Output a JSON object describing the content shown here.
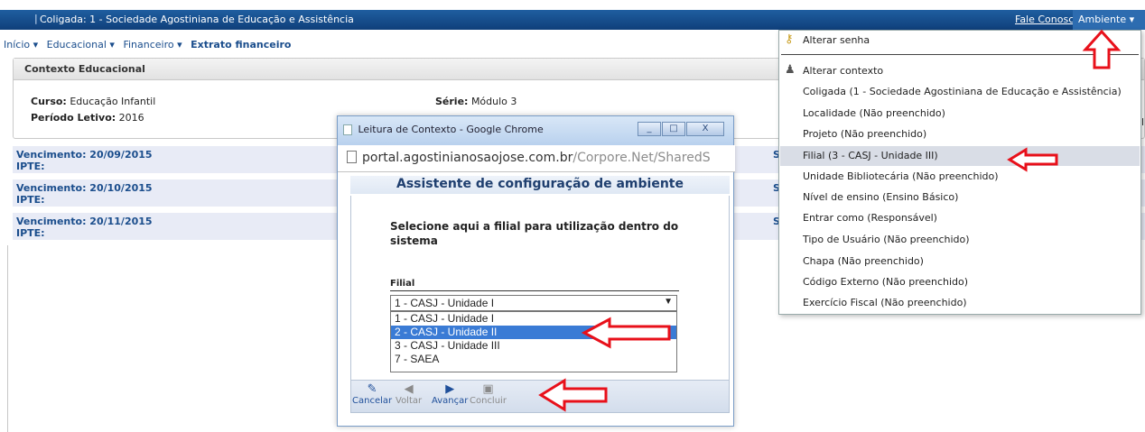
{
  "topbar": {
    "pipe": "|",
    "coligada": "Coligada: 1 - Sociedade Agostiniana de Educação e Assistência",
    "fale_conosco": "Fale Conosco",
    "ambiente": "Ambiente ▾"
  },
  "menubar": {
    "inicio": "Início ▾",
    "educacional": "Educacional ▾",
    "financeiro": "Financeiro ▾",
    "extrato": "Extrato financeiro"
  },
  "contexto": {
    "title": "Contexto Educacional",
    "curso_label": "Curso:",
    "curso_value": "Educação Infantil",
    "periodo_label": "Período Letivo:",
    "periodo_value": "2016",
    "serie_label": "Série:",
    "serie_value": "Módulo 3"
  },
  "boletos": [
    {
      "vencimento": "Vencimento: 20/09/2015",
      "ipte": "IPTE:",
      "s": "S"
    },
    {
      "vencimento": "Vencimento: 20/10/2015",
      "ipte": "IPTE:",
      "s": "S"
    },
    {
      "vencimento": "Vencimento: 20/11/2015",
      "ipte": "IPTE:",
      "s": "S"
    }
  ],
  "dialog": {
    "window_title": "Leitura de Contexto - Google Chrome",
    "win_min": "_",
    "win_max": "□",
    "win_close": "X",
    "url_host": "portal.agostinianosaojose.com.br",
    "url_path": "/Corpore.Net/SharedS",
    "assist_title": "Assistente de configuração de ambiente",
    "instruction": "Selecione aqui a filial para utilização dentro do sistema",
    "filial_label": "Filial",
    "selected": "1 - CASJ - Unidade I",
    "options": [
      "1 - CASJ - Unidade I",
      "2 - CASJ - Unidade II",
      "3 - CASJ - Unidade III",
      "7 - SAEA"
    ],
    "highlighted_option": 1,
    "buttons": {
      "cancelar": "Cancelar",
      "voltar": "Voltar",
      "avancar": "Avançar",
      "concluir": "Concluir"
    }
  },
  "dropdown": {
    "alterar_senha": "Alterar senha",
    "alterar_contexto": "Alterar contexto",
    "items": [
      "Coligada (1 - Sociedade Agostiniana de Educação e Assistência)",
      "Localidade (Não preenchido)",
      "Projeto (Não preenchido)",
      "Filial (3 - CASJ - Unidade III)",
      "Unidade Bibliotecária (Não preenchido)",
      "Nível de ensino (Ensino Básico)",
      "Entrar como (Responsável)",
      "Tipo de Usuário (Não preenchido)",
      "Chapa (Não preenchido)",
      "Código Externo (Não preenchido)",
      "Exercício Fiscal (Não preenchido)"
    ],
    "highlighted_item": 3,
    "side_text": "l"
  },
  "colors": {
    "topbar": "#0f3f7a",
    "link": "#1a4d8c",
    "boleto_bg": "#e8ebf6",
    "selection": "#3a7bd5",
    "annotation_arrow": "#e8101a"
  }
}
